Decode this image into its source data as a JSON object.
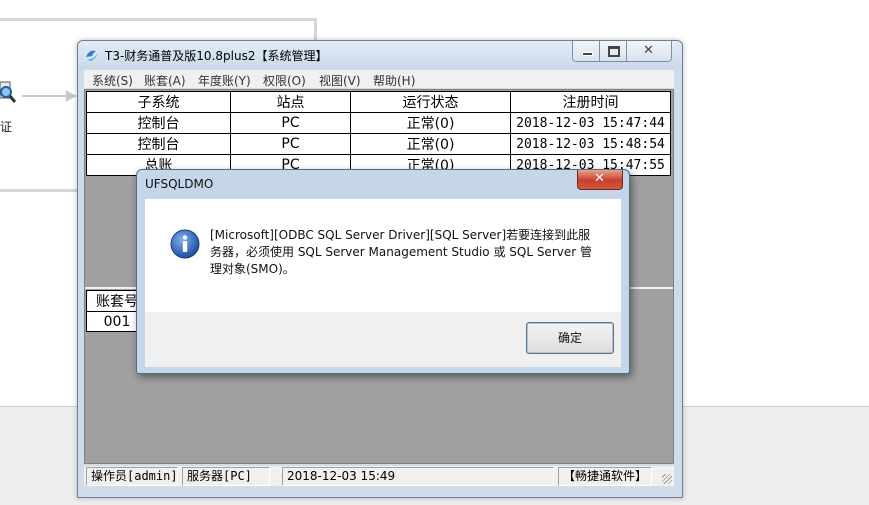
{
  "background": {
    "flow_label": "证"
  },
  "window": {
    "title": "T3-财务通普及版10.8plus2【系统管理】",
    "menu": [
      "系统(S)",
      "账套(A)",
      "年度账(Y)",
      "权限(O)",
      "视图(V)",
      "帮助(H)"
    ],
    "table": {
      "headers": [
        "子系统",
        "站点",
        "运行状态",
        "注册时间"
      ],
      "rows": [
        [
          "控制台",
          "PC",
          "正常(0)",
          "2018-12-03 15:47:44"
        ],
        [
          "控制台",
          "PC",
          "正常(0)",
          "2018-12-03 15:48:54"
        ],
        [
          "总账",
          "PC",
          "正常(0)",
          "2018-12-03 15:47:55"
        ]
      ]
    },
    "account_table": {
      "header": "账套号",
      "rows": [
        "001"
      ]
    },
    "status": {
      "operator": "操作员[admin]",
      "server": "服务器[PC]",
      "datetime": "2018-12-03 15:49",
      "brand": "【畅捷通软件】"
    }
  },
  "dialog": {
    "title": "UFSQLDMO",
    "message_lines": [
      "[Microsoft][ODBC SQL Server Driver][SQL Server]若要连接到此服",
      "务器，必须使用 SQL Server Management Studio 或 SQL Server 管",
      "理对象(SMO)。"
    ],
    "ok_label": "确定",
    "close_glyph": "✕"
  },
  "colors": {
    "window_frame": "#cfdcea",
    "dialog_frame": "#c5d6ea",
    "close_red": "#c8402a",
    "info_blue": "#2a5fb0"
  }
}
